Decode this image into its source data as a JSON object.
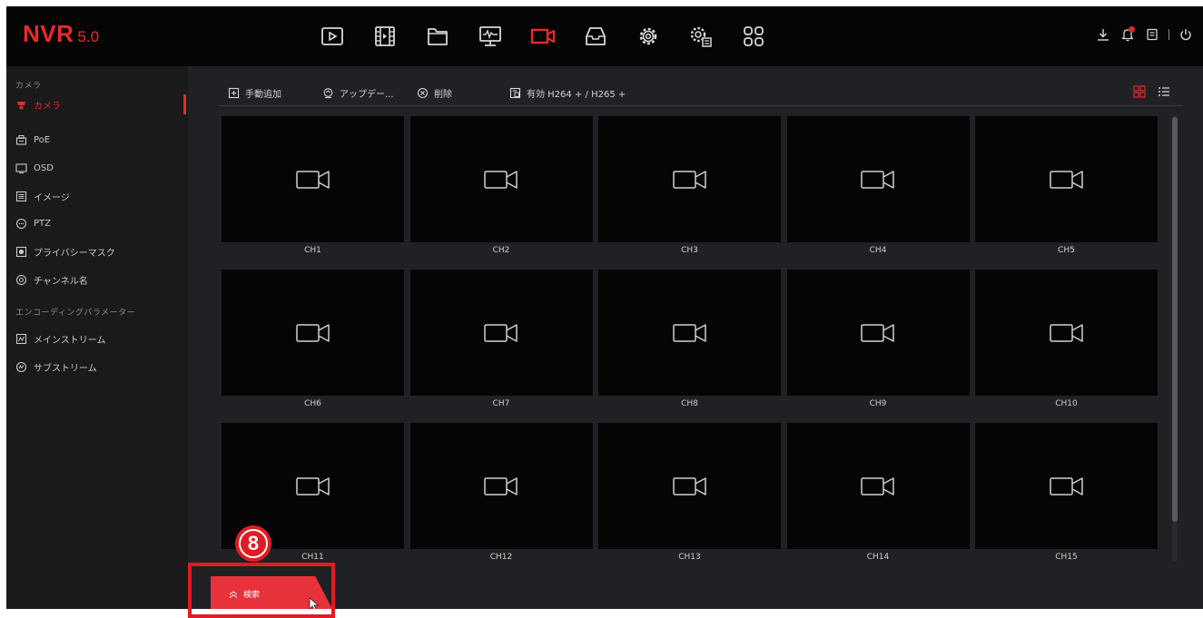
{
  "app": {
    "brand": "NVR",
    "version": "5.0"
  },
  "modules": [
    {
      "name": "playback-icon",
      "active": false
    },
    {
      "name": "film-icon",
      "active": false
    },
    {
      "name": "folder-icon",
      "active": false
    },
    {
      "name": "monitor-icon",
      "active": false
    },
    {
      "name": "camera-icon",
      "active": true
    },
    {
      "name": "inbox-icon",
      "active": false
    },
    {
      "name": "gear-icon",
      "active": false
    },
    {
      "name": "gear-advanced-icon",
      "active": false
    },
    {
      "name": "apps-grid-icon",
      "active": false
    }
  ],
  "sidebar": {
    "section_camera": "カメラ",
    "section_encoding": "エンコーディングパラメーター",
    "camera_items": [
      {
        "label": "カメラ",
        "icon": "camera-icon",
        "active": true
      },
      {
        "label": "PoE",
        "icon": "poe-icon",
        "active": false
      },
      {
        "label": "OSD",
        "icon": "osd-icon",
        "active": false
      },
      {
        "label": "イメージ",
        "icon": "image-icon",
        "active": false
      },
      {
        "label": "PTZ",
        "icon": "ptz-icon",
        "active": false
      },
      {
        "label": "プライバシーマスク",
        "icon": "privacy-mask-icon",
        "active": false
      },
      {
        "label": "チャンネル名",
        "icon": "channel-name-icon",
        "active": false
      }
    ],
    "encoding_items": [
      {
        "label": "メインストリーム",
        "icon": "main-stream-icon",
        "active": false
      },
      {
        "label": "サブストリーム",
        "icon": "sub-stream-icon",
        "active": false
      }
    ]
  },
  "toolbar": {
    "add_manual": "手動追加",
    "update": "アップデー...",
    "delete": "削除",
    "h265": "有効 H264 + / H265 +"
  },
  "channels": [
    "CH1",
    "CH2",
    "CH3",
    "CH4",
    "CH5",
    "CH6",
    "CH7",
    "CH8",
    "CH9",
    "CH10",
    "CH11",
    "CH12",
    "CH13",
    "CH14",
    "CH15"
  ],
  "bottom": {
    "search_label": "検索"
  },
  "annotation": {
    "number": "8"
  },
  "colors": {
    "accent": "#e62a2a",
    "panel": "#202124",
    "sidebar": "#1a1a1b",
    "topbar": "#050505",
    "tile": "#050505",
    "annotation": "#e11b22"
  }
}
